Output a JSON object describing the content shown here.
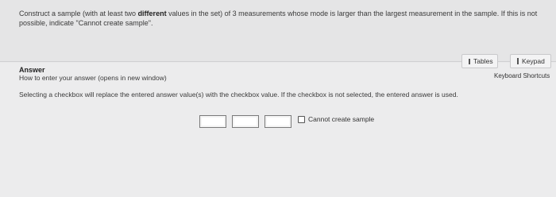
{
  "question": {
    "part1": "Construct a sample (with at least two ",
    "bold": "different",
    "part2": " values in the set) of 3 measurements whose mode is larger than the largest measurement in the sample.  If this is not possible, indicate \"Cannot create sample\"."
  },
  "answer": {
    "title": "Answer",
    "howto_link": "How to enter your answer (opens in new window)",
    "instruction": "Selecting a checkbox will replace the entered answer value(s) with the checkbox value. If the checkbox is not selected, the entered answer is used.",
    "inputs": [
      "",
      "",
      ""
    ],
    "checkbox_label": "Cannot create sample",
    "checkbox_checked": false
  },
  "toolbar": {
    "tables_label": "Tables",
    "keypad_label": "Keypad",
    "shortcuts_label": "Keyboard Shortcuts",
    "tables_icon": "table-icon",
    "keypad_icon": "keypad-icon"
  }
}
